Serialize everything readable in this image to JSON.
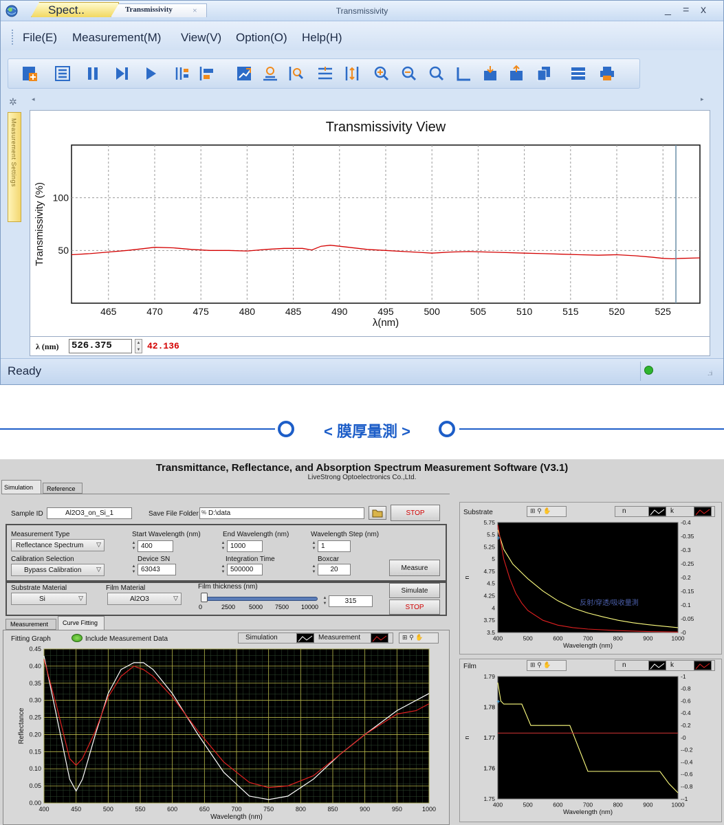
{
  "top_window": {
    "title": "Transmissivity",
    "controls": {
      "minimize": "_",
      "maximize": "=",
      "close": "x"
    },
    "menu": [
      "File(E)",
      "Measurement(M)",
      "View(V)",
      "Option(O)",
      "Help(H)"
    ],
    "menu_underline": [
      "E",
      "M",
      "V",
      "O",
      "H"
    ],
    "toolbar_icons": [
      "new-measure-icon",
      "list-icon",
      "pause-icon",
      "step-icon",
      "play-icon",
      "split-icon",
      "align-icon",
      "trend-icon",
      "peak-icon",
      "peak-find-icon",
      "baseline-icon",
      "scale-icon",
      "zoom-in-icon",
      "zoom-out-icon",
      "zoom-reset-icon",
      "frame-icon",
      "export-icon",
      "import-icon",
      "copy-icon",
      "table-icon",
      "print-icon"
    ],
    "tabs": [
      {
        "label": "Spect..",
        "active": false
      },
      {
        "label": "Transmissivity",
        "active": true,
        "close": "×"
      }
    ],
    "side_panel_label": "Measurement Settings",
    "status": "Ready",
    "readout": {
      "label": "λ (nm)",
      "wavelength": "526.375",
      "value": "42.136"
    }
  },
  "banner": {
    "text": "< 膜厚量測 >"
  },
  "bottom_window": {
    "title": "Transmittance, Reflectance, and Absorption Spectrum Measurement Software (V3.1)",
    "subtitle": "LiveStrong Optoelectronics Co.,Ltd.",
    "tabs": [
      "Simulation",
      "Reference"
    ],
    "sample_id": {
      "label": "Sample ID",
      "value": "Al2O3_on_Si_1"
    },
    "save_folder": {
      "label": "Save File Folder",
      "value": "D:\\data"
    },
    "stop_top": "STOP",
    "measurement_type": {
      "label": "Measurement Type",
      "value": "Reflectance Spectrum"
    },
    "start_wl": {
      "label": "Start Wavelength (nm)",
      "value": "400"
    },
    "end_wl": {
      "label": "End Wavelength (nm)",
      "value": "1000"
    },
    "wl_step": {
      "label": "Wavelength Step (nm)",
      "value": "1"
    },
    "calibration": {
      "label": "Calibration Selection",
      "value": "Bypass Calibration"
    },
    "device_sn": {
      "label": "Device SN",
      "value": "63043"
    },
    "integration": {
      "label": "Integration Time",
      "value": "500000"
    },
    "boxcar": {
      "label": "Boxcar",
      "value": "20"
    },
    "measure_btn": "Measure",
    "substrate": {
      "label": "Substrate Material",
      "value": "Si"
    },
    "film": {
      "label": "Film Material",
      "value": "Al2O3"
    },
    "thickness": {
      "label": "Film thickness (nm)",
      "value": "315",
      "slider_fraction": 0.0,
      "ticks": [
        "0",
        "2500",
        "5000",
        "7500",
        "10000"
      ]
    },
    "simulate_btn": "Simulate",
    "stop_bottom": "STOP",
    "subtabs": [
      "Measurement",
      "Curve Fitting"
    ],
    "fitting": {
      "label": "Fitting Graph",
      "include_label": "Include Measurement Data",
      "legend": [
        "Simulation",
        "Measurement"
      ]
    },
    "right_panels": [
      {
        "label": "Substrate",
        "legend": [
          "n",
          "k"
        ],
        "overlay": "反射/穿透/吸收量測"
      },
      {
        "label": "Film",
        "legend": [
          "n",
          "k"
        ]
      }
    ]
  },
  "chart_data": [
    {
      "type": "line",
      "title": "Transmissivity View",
      "xlabel": "λ(nm)",
      "ylabel": "Transmissivity (%)",
      "xlim": [
        461,
        529
      ],
      "ylim": [
        0,
        150
      ],
      "xticks": [
        465,
        470,
        475,
        480,
        485,
        490,
        495,
        500,
        505,
        510,
        515,
        520,
        525
      ],
      "yticks": [
        50,
        100
      ],
      "grid": true,
      "cursor_x": 526.4,
      "series": [
        {
          "color": "#d40000",
          "x": [
            461,
            463,
            465,
            467,
            469,
            470,
            472,
            474,
            476,
            478,
            480,
            482,
            484,
            486,
            487,
            488,
            489,
            491,
            493,
            495,
            497,
            499,
            500,
            502,
            504,
            506,
            508,
            510,
            512,
            514,
            516,
            518,
            520,
            522,
            524,
            525,
            526,
            527,
            529
          ],
          "y": [
            46,
            47,
            48.5,
            50,
            52,
            53,
            52.5,
            51,
            50,
            50,
            49.5,
            51,
            52,
            52,
            50.5,
            54,
            55,
            53,
            51,
            50,
            49,
            48,
            47.5,
            48.5,
            49,
            48.5,
            48,
            47.5,
            47,
            46.5,
            46,
            45.5,
            46,
            45,
            43.5,
            42.5,
            42.1,
            42.5,
            43
          ]
        }
      ]
    },
    {
      "type": "line",
      "xlabel": "Wavelength (nm)",
      "ylabel": "Reflectance",
      "xlim": [
        400,
        1000
      ],
      "ylim": [
        0,
        0.45
      ],
      "xticks": [
        400,
        450,
        500,
        550,
        600,
        650,
        700,
        750,
        800,
        850,
        900,
        950,
        1000
      ],
      "yticks": [
        0,
        0.05,
        0.1,
        0.15,
        0.2,
        0.25,
        0.3,
        0.35,
        0.4,
        0.45
      ],
      "grid": true,
      "series": [
        {
          "name": "Simulation",
          "color": "#ffffff",
          "x": [
            400,
            420,
            440,
            450,
            460,
            480,
            500,
            520,
            540,
            555,
            570,
            600,
            640,
            680,
            720,
            750,
            780,
            820,
            860,
            900,
            950,
            1000
          ],
          "y": [
            0.43,
            0.25,
            0.07,
            0.035,
            0.07,
            0.2,
            0.32,
            0.39,
            0.41,
            0.41,
            0.39,
            0.32,
            0.2,
            0.09,
            0.02,
            0.01,
            0.02,
            0.07,
            0.14,
            0.2,
            0.27,
            0.32
          ]
        },
        {
          "name": "Measurement",
          "color": "#e02020",
          "x": [
            400,
            420,
            440,
            450,
            460,
            480,
            500,
            520,
            540,
            555,
            570,
            600,
            640,
            680,
            720,
            750,
            780,
            820,
            860,
            900,
            950,
            980,
            1000
          ],
          "y": [
            0.42,
            0.28,
            0.13,
            0.11,
            0.13,
            0.21,
            0.31,
            0.37,
            0.4,
            0.39,
            0.37,
            0.31,
            0.21,
            0.12,
            0.06,
            0.045,
            0.05,
            0.08,
            0.14,
            0.2,
            0.26,
            0.27,
            0.29
          ]
        }
      ]
    },
    {
      "type": "line",
      "xlabel": "Wavelength (nm)",
      "ylabel": "n",
      "xlim": [
        400,
        1000
      ],
      "ylim": [
        3.5,
        5.75
      ],
      "y2lim": [
        0,
        0.4
      ],
      "xticks": [
        400,
        500,
        600,
        700,
        800,
        900,
        1000
      ],
      "yticks": [
        3.5,
        3.75,
        4,
        4.25,
        4.5,
        4.75,
        5,
        5.25,
        5.5,
        5.75
      ],
      "y2ticks": [
        0,
        0.05,
        0.1,
        0.15,
        0.2,
        0.25,
        0.3,
        0.35,
        0.4
      ],
      "series": [
        {
          "name": "n",
          "color": "#ffff80",
          "x": [
            400,
            420,
            450,
            500,
            550,
            600,
            650,
            700,
            750,
            800,
            850,
            900,
            950,
            1000
          ],
          "y": [
            5.6,
            5.2,
            4.9,
            4.6,
            4.35,
            4.15,
            4.0,
            3.9,
            3.82,
            3.75,
            3.7,
            3.66,
            3.63,
            3.6
          ]
        },
        {
          "name": "k",
          "color": "#e02020",
          "x": [
            400,
            420,
            440,
            460,
            480,
            500,
            550,
            600,
            650,
            700,
            800,
            900,
            1000
          ],
          "y": [
            5.7,
            5.0,
            4.6,
            4.3,
            4.1,
            3.95,
            3.75,
            3.65,
            3.6,
            3.57,
            3.54,
            3.52,
            3.51
          ]
        }
      ]
    },
    {
      "type": "line",
      "xlabel": "Wavelength (nm)",
      "ylabel": "n",
      "xlim": [
        400,
        1000
      ],
      "ylim": [
        1.75,
        1.79
      ],
      "y2lim": [
        -1,
        1
      ],
      "xticks": [
        400,
        500,
        600,
        700,
        800,
        900,
        1000
      ],
      "yticks": [
        1.75,
        1.76,
        1.76,
        1.77,
        1.77,
        1.78,
        1.78,
        1.79
      ],
      "y2ticks": [
        -1,
        -0.8,
        -0.6,
        -0.4,
        -0.2,
        0,
        0.2,
        0.4,
        0.6,
        0.8,
        1
      ],
      "series": [
        {
          "name": "n",
          "color": "#ffff80",
          "x": [
            400,
            410,
            420,
            480,
            510,
            600,
            640,
            700,
            900,
            940,
            970,
            1000
          ],
          "y": [
            1.788,
            1.782,
            1.781,
            1.781,
            1.774,
            1.774,
            1.774,
            1.759,
            1.759,
            1.759,
            1.755,
            1.752
          ]
        },
        {
          "name": "k",
          "color": "#c03030",
          "x": [
            400,
            1000
          ],
          "y": [
            1.7715,
            1.7715
          ]
        }
      ]
    }
  ]
}
